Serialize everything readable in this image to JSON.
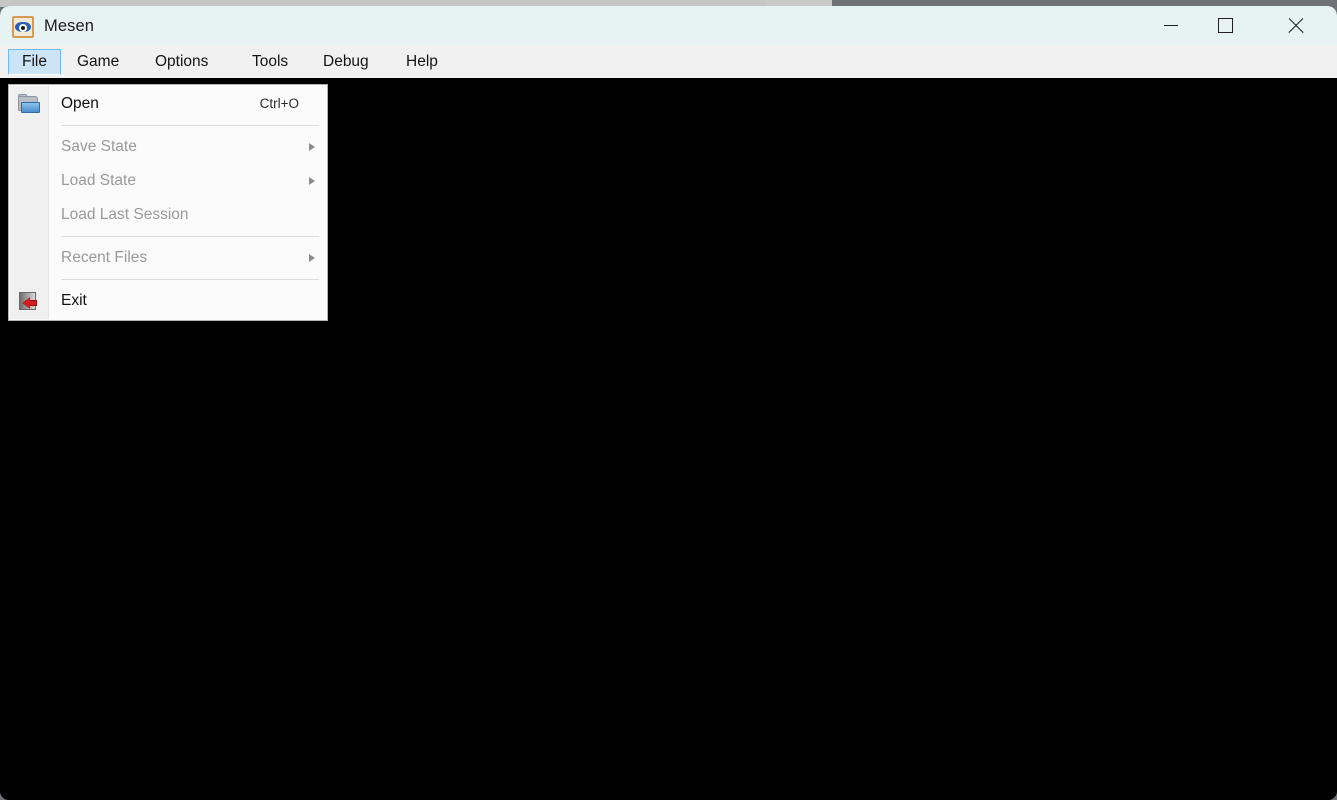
{
  "window": {
    "title": "Mesen",
    "app_icon": "mesen-eye-icon",
    "controls": {
      "minimize": "minimize-button",
      "maximize": "maximize-button",
      "close": "close-button"
    },
    "titlebar_color": "#e7f3f3",
    "viewport_color": "#000000"
  },
  "menubar": {
    "items": [
      {
        "label": "File",
        "active": true
      },
      {
        "label": "Game",
        "active": false
      },
      {
        "label": "Options",
        "active": false
      },
      {
        "label": "Tools",
        "active": false
      },
      {
        "label": "Debug",
        "active": false
      },
      {
        "label": "Help",
        "active": false
      }
    ]
  },
  "file_menu": {
    "open_label": "Open",
    "open_shortcut": "Ctrl+O",
    "save_state_label": "Save State",
    "load_state_label": "Load State",
    "load_last_session_label": "Load Last Session",
    "recent_files_label": "Recent Files",
    "exit_label": "Exit",
    "highlight_color": "#cce4f7",
    "disabled_color": "#9a9a9a"
  }
}
